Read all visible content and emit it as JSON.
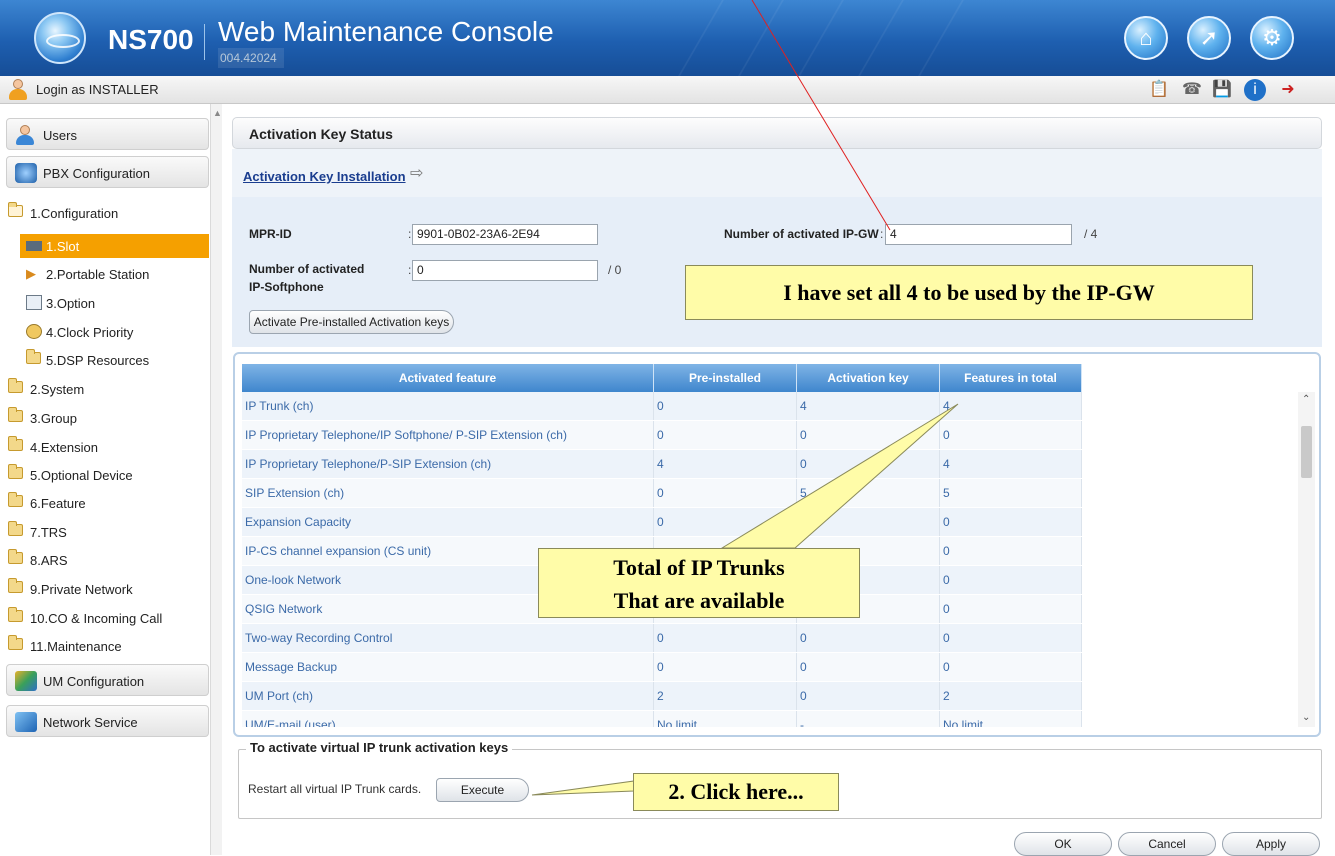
{
  "header": {
    "product": "NS700",
    "title": "Web Maintenance Console",
    "version": "004.42024"
  },
  "toolbar": {
    "login_text": "Login as INSTALLER"
  },
  "sidebar": {
    "users": "Users",
    "pbx_config": "PBX Configuration",
    "configuration": "1.Configuration",
    "sub_items": [
      "1.Slot",
      "2.Portable Station",
      "3.Option",
      "4.Clock Priority",
      "5.DSP Resources"
    ],
    "folders": [
      "2.System",
      "3.Group",
      "4.Extension",
      "5.Optional Device",
      "6.Feature",
      "7.TRS",
      "8.ARS",
      "9.Private Network",
      "10.CO & Incoming Call",
      "11.Maintenance"
    ],
    "um_config": "UM Configuration",
    "network_service": "Network Service"
  },
  "page": {
    "title": "Activation Key Status",
    "install_link": "Activation Key Installation"
  },
  "form": {
    "mpr_label": "MPR-ID",
    "mpr_value": "9901-0B02-23A6-2E94",
    "softphone_label": "Number of activated IP-Softphone",
    "softphone_value": "0",
    "softphone_max": "/ 0",
    "ipgw_label": "Number of activated IP-GW",
    "ipgw_value": "4",
    "ipgw_max": "/ 4",
    "activate_btn": "Activate Pre-installed Activation keys"
  },
  "table": {
    "headers": [
      "Activated feature",
      "Pre-installed",
      "Activation key",
      "Features in total"
    ],
    "rows": [
      [
        "IP Trunk (ch)",
        "0",
        "4",
        "4"
      ],
      [
        "IP Proprietary Telephone/IP Softphone/ P-SIP Extension (ch)",
        "0",
        "0",
        "0"
      ],
      [
        "IP Proprietary Telephone/P-SIP Extension (ch)",
        "4",
        "0",
        "4"
      ],
      [
        "SIP Extension (ch)",
        "0",
        "5",
        "5"
      ],
      [
        "Expansion Capacity",
        "0",
        "",
        "0"
      ],
      [
        "IP-CS channel expansion (CS unit)",
        "",
        "",
        "0"
      ],
      [
        "One-look Network",
        "",
        "",
        "0"
      ],
      [
        "QSIG Network",
        "",
        "",
        "0"
      ],
      [
        "Two-way Recording Control",
        "0",
        "0",
        "0"
      ],
      [
        "Message Backup",
        "0",
        "0",
        "0"
      ],
      [
        "UM Port (ch)",
        "2",
        "0",
        "2"
      ],
      [
        "UM/E-mail (user)",
        "No limit",
        "-",
        "No limit"
      ]
    ]
  },
  "virtual": {
    "legend": "To activate virtual IP trunk activation keys",
    "restart_text": "Restart all virtual IP Trunk cards.",
    "execute_btn": "Execute"
  },
  "footer": {
    "ok": "OK",
    "cancel": "Cancel",
    "apply": "Apply"
  },
  "annotations": {
    "callout_ipgw": "I have set all 4 to be used by the IP-GW",
    "callout_total_line1": "Total of IP Trunks",
    "callout_total_line2": "That are available",
    "callout_click": "2. Click here..."
  }
}
